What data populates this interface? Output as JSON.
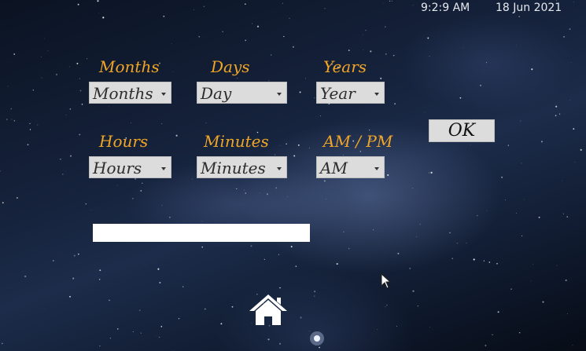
{
  "status_bar": {
    "time": "9:2:9 AM",
    "date": "18 Jun 2021"
  },
  "form": {
    "months": {
      "label": "Months",
      "value": "Months"
    },
    "days": {
      "label": "Days",
      "value": "Day"
    },
    "years": {
      "label": "Years",
      "value": "Year"
    },
    "hours": {
      "label": "Hours",
      "value": "Hours"
    },
    "minutes": {
      "label": "Minutes",
      "value": "Minutes"
    },
    "ampm": {
      "label": "AM / PM",
      "value": "AM"
    },
    "ok_label": "OK",
    "text_input_value": ""
  },
  "icons": {
    "home": "home-icon",
    "dropdown_arrow": "chevron-down-icon",
    "cursor": "mouse-pointer-icon"
  },
  "colors": {
    "label": "#f0a526",
    "control_bg": "#dcdcdc",
    "status_text": "#e6e9ef"
  }
}
